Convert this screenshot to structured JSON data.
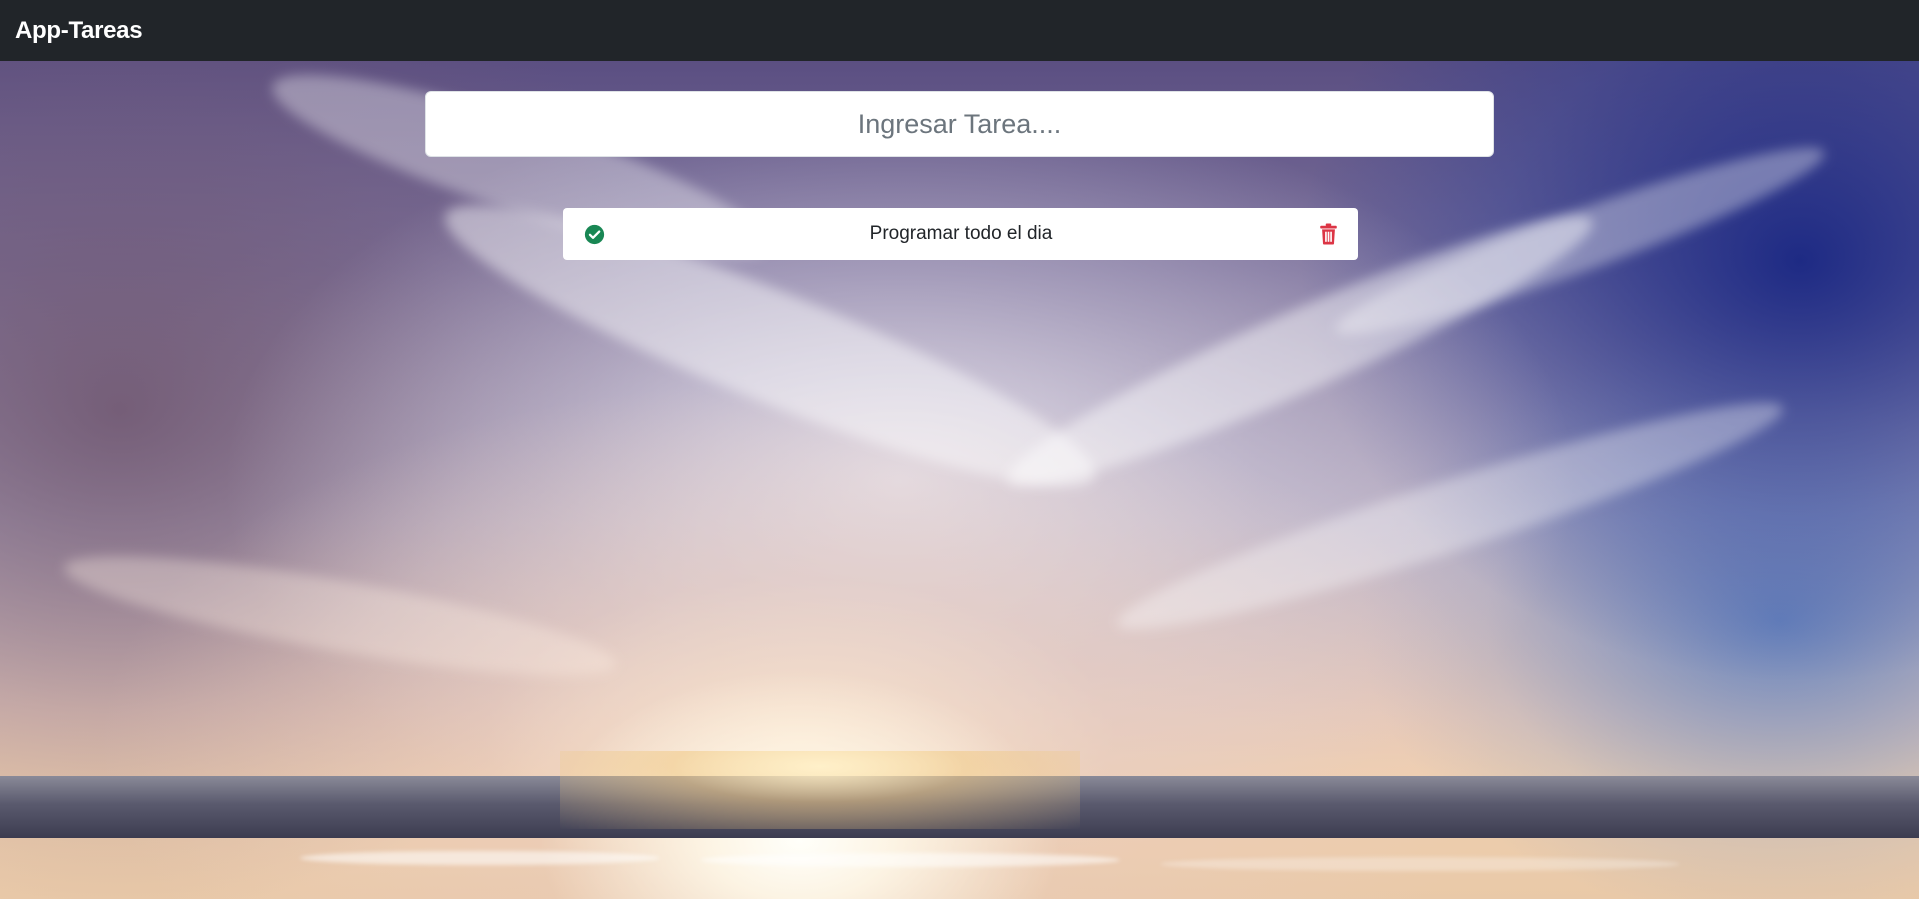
{
  "navbar": {
    "brand": "App-Tareas"
  },
  "task_form": {
    "placeholder": "Ingresar Tarea....",
    "value": ""
  },
  "tasks": [
    {
      "text": "Programar todo el dia",
      "complete_icon": "check-circle-icon",
      "delete_icon": "trash-icon"
    }
  ],
  "colors": {
    "navbar_bg": "#212529",
    "complete_icon": "#198754",
    "delete_icon": "#dc3545"
  },
  "background": {
    "image": "sky-sunset-over-sea"
  }
}
